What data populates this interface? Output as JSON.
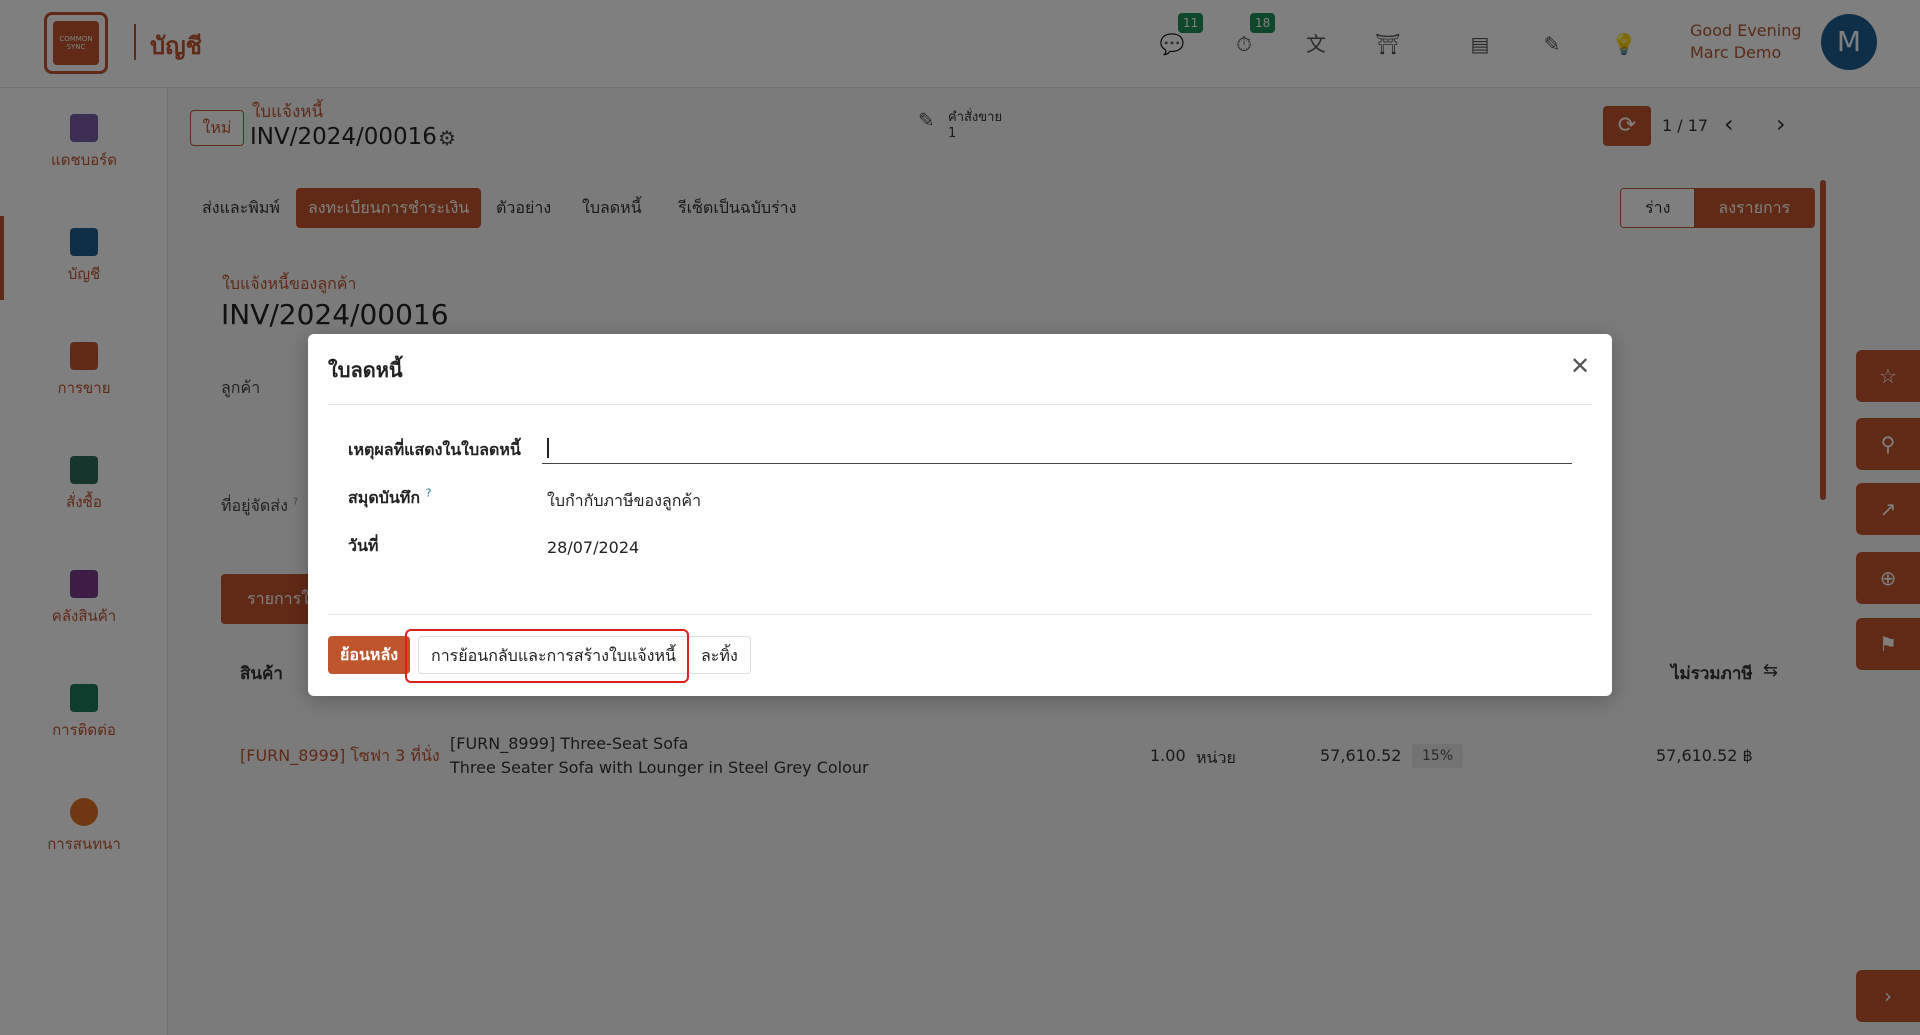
{
  "app": {
    "logo_text": "COMMON SYNC",
    "title": "บัญชี",
    "badges": {
      "messages": "11",
      "activities": "18"
    },
    "greeting_line1": "Good Evening",
    "greeting_line2": "Marc Demo",
    "avatar_initial": "M"
  },
  "sidebar": {
    "items": [
      {
        "label": "แดชบอร์ด",
        "color": "#7a5ca8"
      },
      {
        "label": "บัญชี",
        "color": "#1f5f93"
      },
      {
        "label": "การขาย",
        "color": "#c0542c"
      },
      {
        "label": "สั่งซื้อ",
        "color": "#2a6b5a"
      },
      {
        "label": "คลังสินค้า",
        "color": "#7a3b8c"
      },
      {
        "label": "การติดต่อ",
        "color": "#1f7a5a"
      },
      {
        "label": "การสนทนา",
        "color": "#e07020"
      }
    ]
  },
  "header": {
    "new_label": "ใหม่",
    "breadcrumb_parent": "ใบแจ้งหนี้",
    "breadcrumb_current": "INV/2024/00016",
    "smart_button_label": "คำสั่งขาย",
    "smart_button_count": "1",
    "pager": "1 / 17"
  },
  "actions": {
    "send_print": "ส่งและพิมพ์",
    "register_payment": "ลงทะเบียนการชำระเงิน",
    "preview": "ตัวอย่าง",
    "credit_note": "ใบลดหนี้",
    "reset_draft": "รีเซ็ตเป็นฉบับร่าง"
  },
  "status": {
    "draft": "ร่าง",
    "posted": "ลงรายการ"
  },
  "form": {
    "doc_type": "ใบแจ้งหนี้ของลูกค้า",
    "doc_number": "INV/2024/00016",
    "customer_label": "ลูกค้า",
    "delivery_address_label": "ที่อยู่จัดส่ง",
    "delivery_address_tooltip": "?",
    "tab_invoice_lines": "รายการในใบแจ้งหนี้",
    "col_product": "สินค้า",
    "col_untaxed": "ไม่รวมภาษี",
    "line": {
      "product": "[FURN_8999] โซฟา 3 ที่นั่ง",
      "desc1": "[FURN_8999] Three-Seat Sofa",
      "desc2": "Three Seater Sofa with Lounger in Steel Grey Colour",
      "qty": "1.00",
      "uom": "หน่วย",
      "price": "57,610.52",
      "tax": "15%",
      "subtotal": "57,610.52 ฿"
    }
  },
  "dialog": {
    "title": "ใบลดหนี้",
    "reason_label": "เหตุผลที่แสดงในใบลดหนี้",
    "reason_value": "",
    "journal_label": "สมุดบันทึก",
    "journal_tooltip": "?",
    "journal_value": "ใบกำกับภาษีของลูกค้า",
    "date_label": "วันที่",
    "date_value": "28/07/2024",
    "btn_reverse": "ย้อนหลัง",
    "btn_reverse_create": "การย้อนกลับและการสร้างใบแจ้งหนี้",
    "btn_discard": "ละทิ้ง"
  }
}
